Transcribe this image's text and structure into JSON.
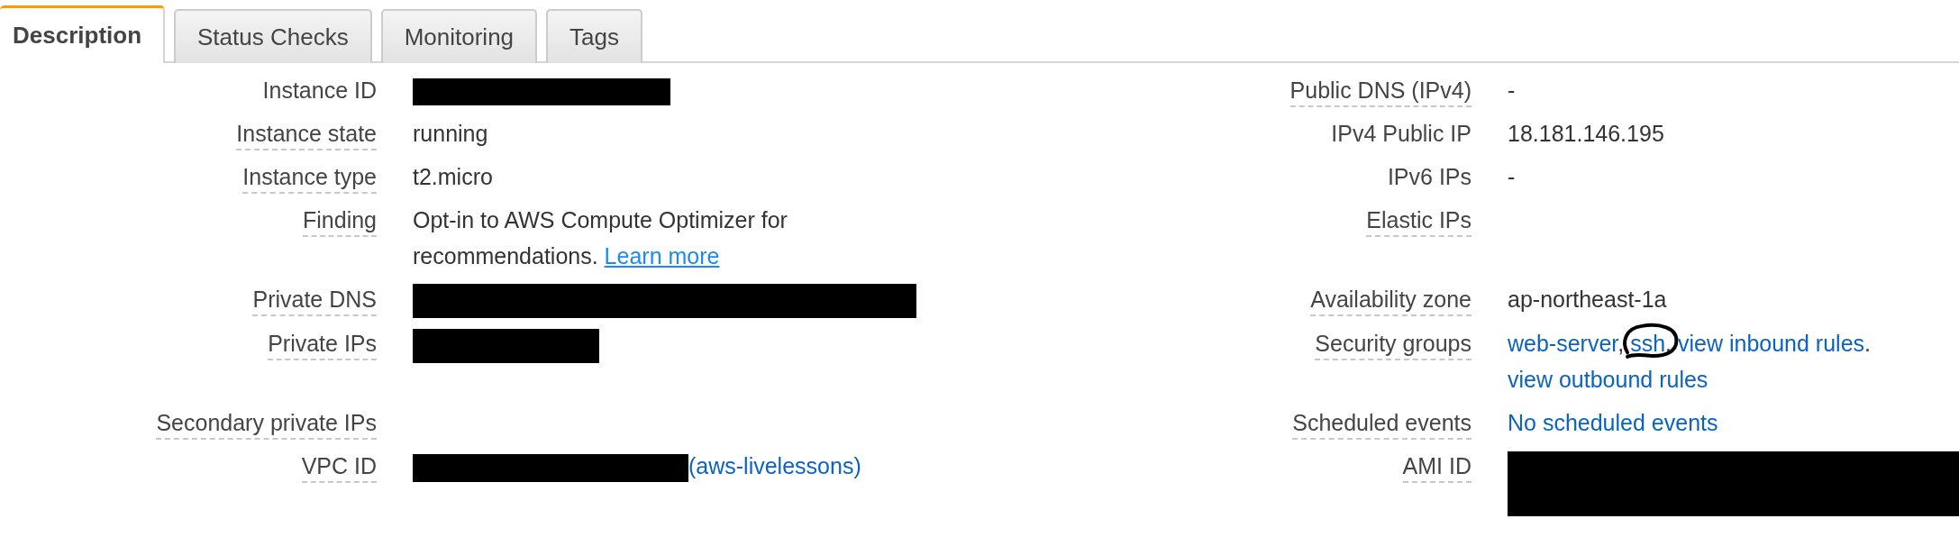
{
  "tabs": [
    {
      "label": "Description",
      "selected": true
    },
    {
      "label": "Status Checks",
      "selected": false
    },
    {
      "label": "Monitoring",
      "selected": false
    },
    {
      "label": "Tags",
      "selected": false
    }
  ],
  "rows": [
    {
      "left": {
        "label": "Instance ID",
        "help": false,
        "parts": [
          {
            "kind": "redacted"
          }
        ]
      },
      "right": {
        "label": "Public DNS (IPv4)",
        "help": true,
        "parts": [
          {
            "kind": "text",
            "text": "-"
          }
        ]
      }
    },
    {
      "left": {
        "label": "Instance state",
        "help": true,
        "parts": [
          {
            "kind": "text",
            "text": "running"
          }
        ]
      },
      "right": {
        "label": "IPv4 Public IP",
        "help": false,
        "parts": [
          {
            "kind": "text",
            "text": "18.181.146.195"
          }
        ]
      }
    },
    {
      "left": {
        "label": "Instance type",
        "help": true,
        "parts": [
          {
            "kind": "text",
            "text": "t2.micro"
          }
        ]
      },
      "right": {
        "label": "IPv6 IPs",
        "help": false,
        "parts": [
          {
            "kind": "text",
            "text": "-"
          }
        ]
      }
    },
    {
      "left": {
        "label": "Finding",
        "help": true,
        "parts": [
          {
            "kind": "text",
            "text": "Opt-in to AWS Compute Optimizer for recommendations. "
          },
          {
            "kind": "link",
            "text": "Learn more",
            "underlined": true
          }
        ]
      },
      "right": {
        "label": "Elastic IPs",
        "help": true
      }
    },
    {
      "left": {
        "label": "Private DNS",
        "help": true,
        "parts": [
          {
            "kind": "redacted"
          }
        ]
      },
      "right": {
        "label": "Availability zone",
        "help": true,
        "parts": [
          {
            "kind": "text",
            "text": "ap-northeast-1a"
          }
        ]
      }
    },
    {
      "left": {
        "label": "Private IPs",
        "help": true,
        "parts": [
          {
            "kind": "redacted"
          }
        ]
      },
      "right": {
        "label": "Security groups",
        "help": true,
        "parts": [
          {
            "kind": "link",
            "text": "web-server"
          },
          {
            "kind": "text",
            "text": ", "
          },
          {
            "kind": "link",
            "text": "ssh",
            "circled": true
          },
          {
            "kind": "text",
            "text": ". "
          },
          {
            "kind": "link",
            "text": "view inbound rules"
          },
          {
            "kind": "text",
            "text": ". "
          },
          {
            "kind": "link",
            "text": "view outbound rules"
          }
        ]
      }
    },
    {
      "left": {
        "label": "Secondary private IPs",
        "help": true
      },
      "right": {
        "label": "Scheduled events",
        "help": true,
        "parts": [
          {
            "kind": "link",
            "text": "No scheduled events"
          }
        ]
      }
    },
    {
      "left": {
        "label": "VPC ID",
        "help": true,
        "parts": [
          {
            "kind": "redacted"
          },
          {
            "kind": "link",
            "text": "(aws-livelessons)"
          }
        ]
      },
      "right": {
        "label": "AMI ID",
        "help": true,
        "parts": [
          {
            "kind": "redacted"
          }
        ]
      }
    }
  ]
}
